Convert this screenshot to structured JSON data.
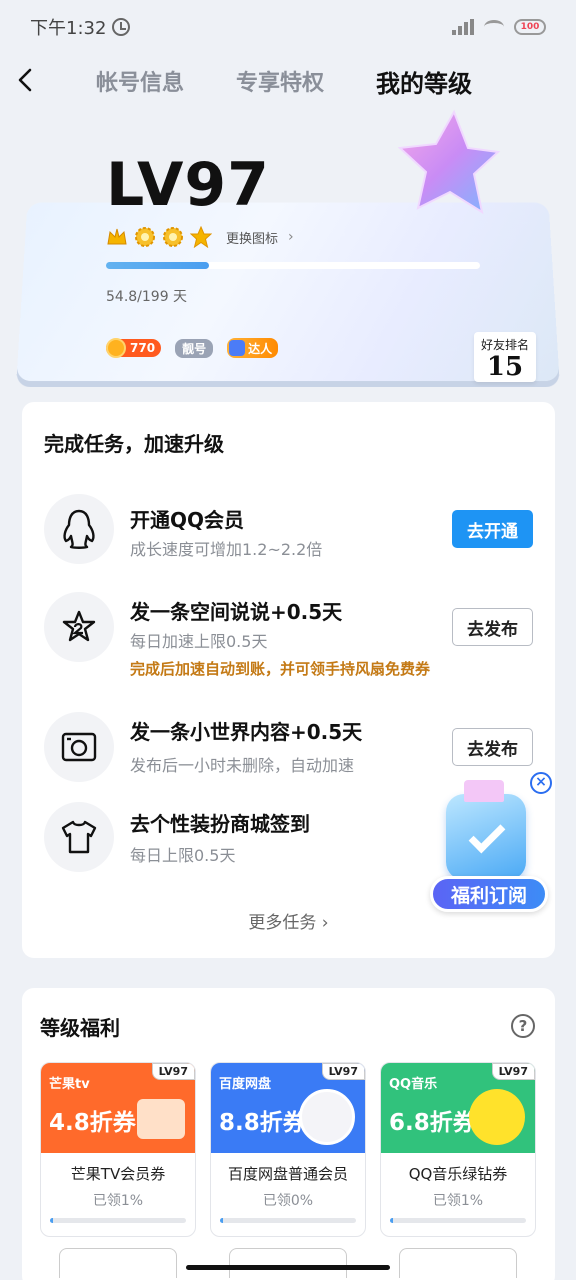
{
  "status_bar": {
    "time": "下午1:32",
    "battery": "100"
  },
  "nav": {
    "tabs": [
      {
        "label": "帐号信息"
      },
      {
        "label": "专享特权"
      },
      {
        "label": "我的等级"
      }
    ]
  },
  "level": {
    "title": "LV97",
    "change_icon": "更换图标",
    "progress_text": "54.8/199 天",
    "progress_fraction": 0.275,
    "coin_count": "770",
    "pretty_tag": "靓号",
    "expert_tag": "达人",
    "friend_rank_label": "好友排名",
    "friend_rank_value": "15",
    "badges": [
      "crown-icon",
      "sun-icon",
      "sun-icon",
      "star-icon"
    ]
  },
  "tasks": {
    "title": "完成任务，加速升级",
    "items": [
      {
        "name": "开通QQ会员",
        "desc": "成长速度可增加1.2~2.2倍",
        "button": "去开通",
        "icon": "penguin-icon"
      },
      {
        "name": "发一条空间说说+0.5天",
        "desc": "每日加速上限0.5天",
        "note": "完成后加速自动到账，并可领手持风扇免费券",
        "button": "去发布",
        "icon": "star-outline-icon"
      },
      {
        "name": "发一条小世界内容+0.5天",
        "desc": "发布后一小时未删除，自动加速",
        "button": "去发布",
        "icon": "camera-icon"
      },
      {
        "name": "去个性装扮商城签到",
        "desc": "每日上限0.5天",
        "icon": "tshirt-icon"
      }
    ],
    "more": "更多任务"
  },
  "promo": {
    "label": "福利订阅"
  },
  "benefits": {
    "title": "等级福利",
    "coupons": [
      {
        "brand": "芒果tv",
        "discount": "4.8折券",
        "lv": "LV97",
        "name": "芒果TV会员券",
        "claimed": "已领1%",
        "claimed_fraction": 0.01,
        "color": "#ff6a2b"
      },
      {
        "brand": "百度网盘",
        "discount": "8.8折券",
        "lv": "LV97",
        "name": "百度网盘普通会员",
        "claimed": "已领0%",
        "claimed_fraction": 0.0,
        "color": "#3a7bf5"
      },
      {
        "brand": "QQ音乐",
        "discount": "6.8折券",
        "lv": "LV97",
        "name": "QQ音乐绿钻券",
        "claimed": "已领1%",
        "claimed_fraction": 0.01,
        "color": "#31c27c"
      }
    ]
  }
}
